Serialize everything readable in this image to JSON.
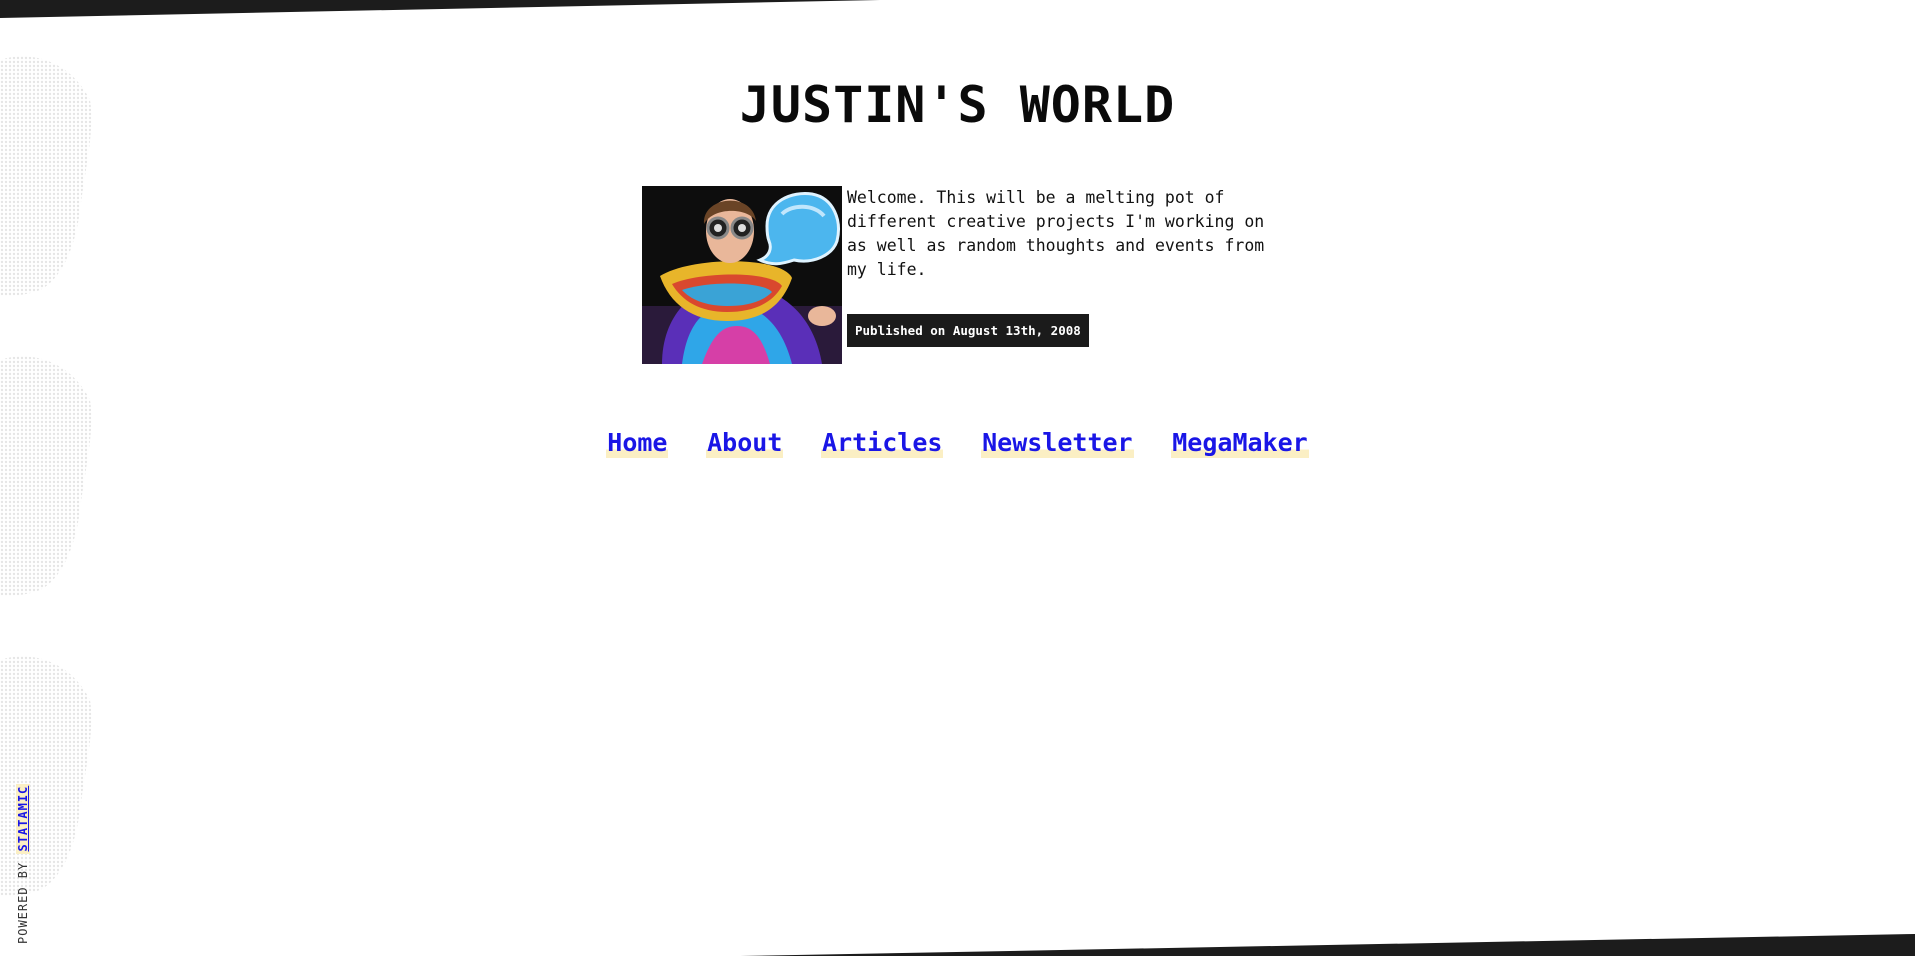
{
  "site": {
    "title": "JUSTIN'S WORLD"
  },
  "post": {
    "image_alt": "Photo of Justin wearing a colorful jacket and novelty glasses with a speech bubble",
    "body": "Welcome. This will be a melting pot of different creative projects I'm working on as well as random thoughts and events from my life.",
    "published": "Published on August 13th, 2008"
  },
  "nav": {
    "items": [
      {
        "label": "Home"
      },
      {
        "label": "About"
      },
      {
        "label": "Articles"
      },
      {
        "label": "Newsletter"
      },
      {
        "label": "MegaMaker"
      }
    ]
  },
  "footer": {
    "powered_by": "POWERED BY",
    "brand": "STATAMIC"
  },
  "colors": {
    "stripe": "#1c1c1c",
    "link": "#1a16e6",
    "link_highlight": "#fbefc4",
    "badge_bg": "#1b1b1b"
  }
}
